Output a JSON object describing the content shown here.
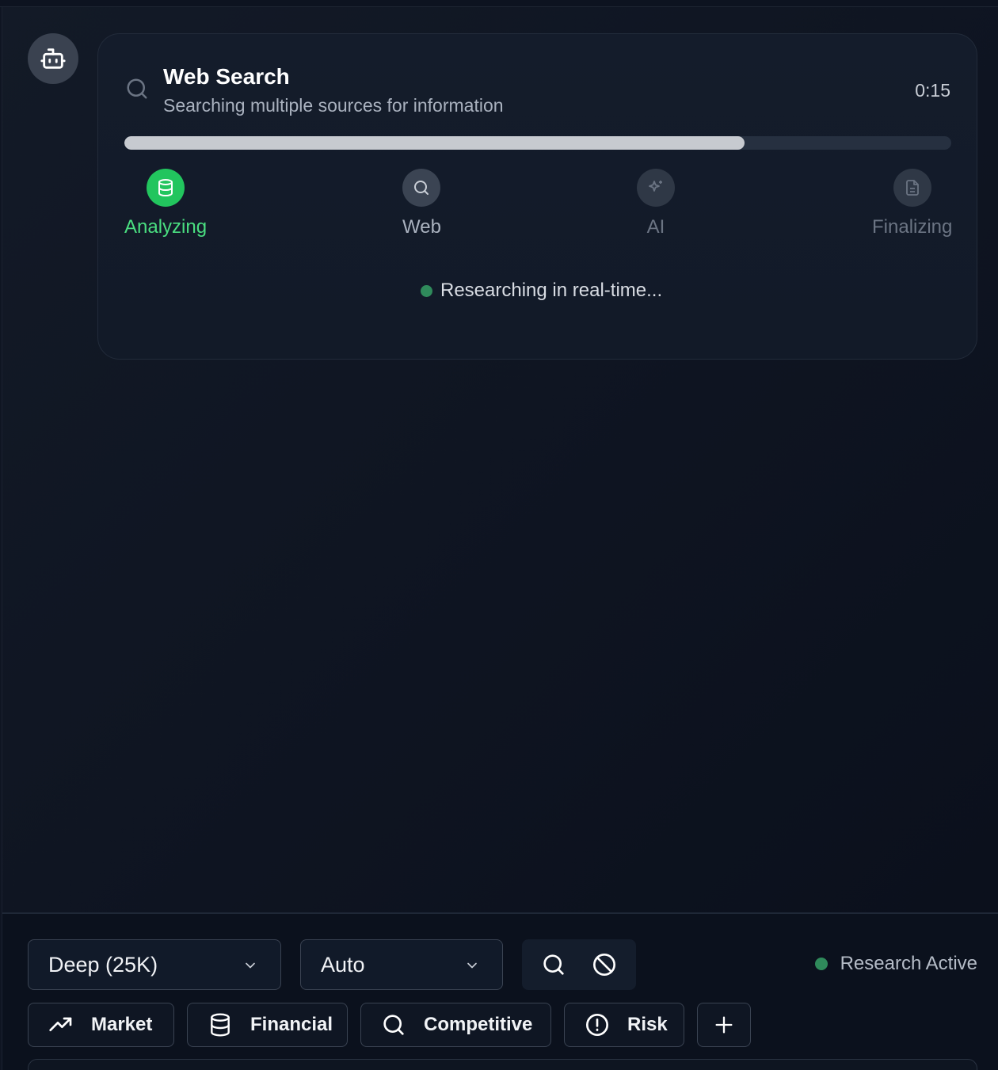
{
  "assistant": {
    "avatar_icon": "bot-icon"
  },
  "progress_card": {
    "icon": "search-icon",
    "title": "Web Search",
    "subtitle": "Searching multiple sources for information",
    "elapsed": "0:15",
    "progress": 0.75,
    "steps": [
      {
        "label": "Analyzing",
        "icon": "database-icon",
        "state": "active",
        "color": "#22c55e"
      },
      {
        "label": "Web",
        "icon": "search-icon",
        "state": "current"
      },
      {
        "label": "AI",
        "icon": "sparkles-icon",
        "state": "pending"
      },
      {
        "label": "Finalizing",
        "icon": "document-icon",
        "state": "pending"
      }
    ],
    "live_status": "Researching in real-time..."
  },
  "controls": {
    "depth_select": {
      "value": "Deep (25K)"
    },
    "mode_select": {
      "value": "Auto"
    },
    "tool_buttons": [
      "search-icon",
      "ban-icon"
    ],
    "research_status": {
      "label": "Research Active",
      "color": "#2f8a5b"
    }
  },
  "quick_actions": [
    {
      "label": "Market",
      "icon": "trending-up-icon"
    },
    {
      "label": "Financial",
      "icon": "database-icon"
    },
    {
      "label": "Competitive",
      "icon": "search-icon"
    },
    {
      "label": "Risk",
      "icon": "alert-circle-icon"
    },
    {
      "label": "",
      "icon": "plus-icon"
    }
  ]
}
